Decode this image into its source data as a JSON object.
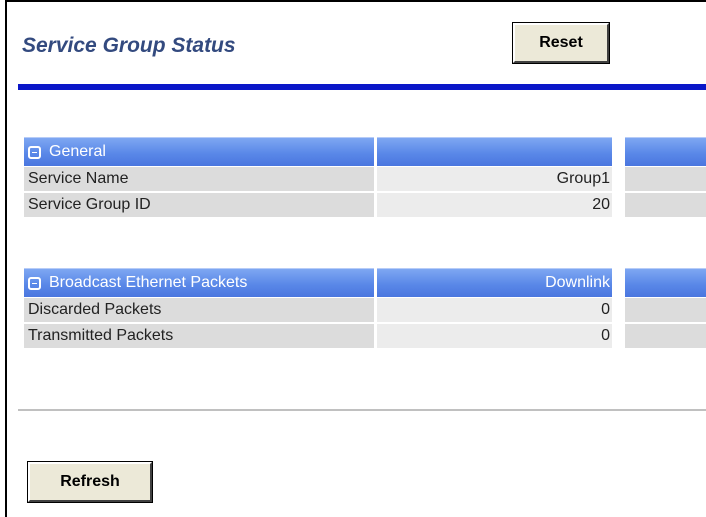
{
  "header": {
    "title": "Service Group Status",
    "reset_label": "Reset"
  },
  "general": {
    "title": "General",
    "rows": [
      {
        "label": "Service Name",
        "value": "Group1"
      },
      {
        "label": "Service Group ID",
        "value": "20"
      }
    ]
  },
  "broadcast": {
    "title": "Broadcast Ethernet Packets",
    "column": "Downlink",
    "rows": [
      {
        "label": "Discarded Packets",
        "value": "0"
      },
      {
        "label": "Transmitted Packets",
        "value": "0"
      }
    ]
  },
  "footer": {
    "refresh_label": "Refresh"
  },
  "icons": {
    "collapse": "collapse-icon"
  },
  "colors": {
    "section_header": "#5a88e8",
    "title": "#334a7f",
    "rule": "#0a16c8"
  }
}
